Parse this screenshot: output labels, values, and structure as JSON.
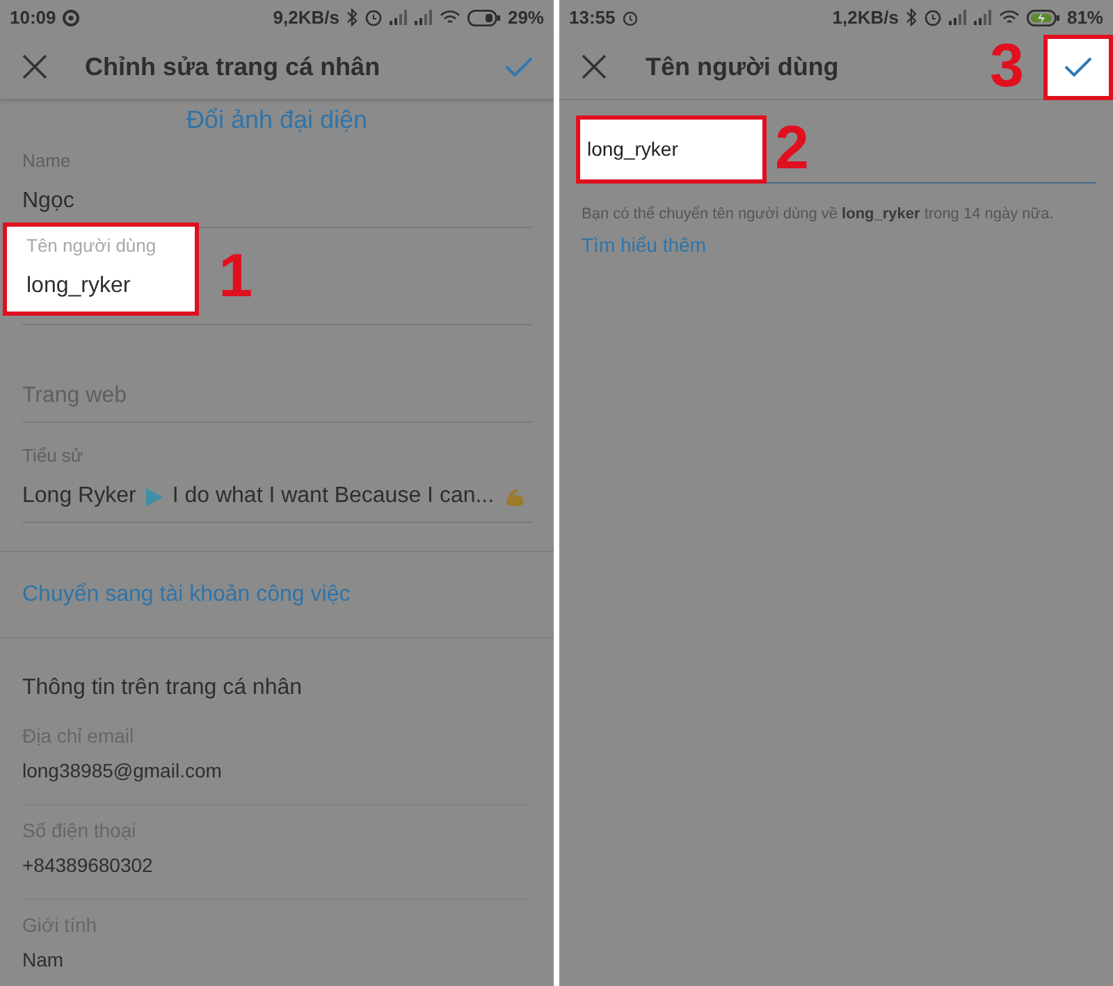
{
  "left_screen": {
    "status_bar": {
      "time": "10:09",
      "speed": "9,2KB/s",
      "battery": "29%",
      "charging": false
    },
    "header": {
      "title": "Chỉnh sửa trang cá nhân"
    },
    "change_photo_link": "Đổi ảnh đại diện",
    "fields": [
      {
        "kind": "text",
        "label": "Name",
        "value": "Ngọc",
        "highlighted": false
      },
      {
        "kind": "text",
        "label": "Tên người dùng",
        "value": "long_ryker",
        "highlighted": true,
        "step": "1"
      },
      {
        "kind": "empty",
        "placeholder": "Trang web",
        "highlighted": false
      },
      {
        "kind": "bio",
        "label": "Tiểu sử",
        "name": "Long Ryker",
        "value": "I do what I want Because I can...",
        "highlighted": false
      }
    ],
    "switch_link": "Chuyển sang tài khoản công việc",
    "private_section": {
      "title": "Thông tin trên trang cá nhân",
      "fields": [
        {
          "label": "Địa chỉ email",
          "value": "long38985@gmail.com"
        },
        {
          "label": "Số điện thoại",
          "value": "+84389680302"
        },
        {
          "label": "Giới tính",
          "value": "Nam"
        }
      ]
    }
  },
  "right_screen": {
    "status_bar": {
      "time": "13:55",
      "speed": "1,2KB/s",
      "battery": "81%",
      "charging": true
    },
    "header": {
      "title": "Tên người dùng",
      "confirm_highlighted": true,
      "confirm_step": "3"
    },
    "username_field": {
      "value": "long_ryker",
      "highlighted": true,
      "step": "2"
    },
    "help_text": "Bạn có thể chuyển tên người dùng về **long_ryker** trong 14 ngày nữa.",
    "learn_more_link": "Tìm hiểu thêm"
  }
}
